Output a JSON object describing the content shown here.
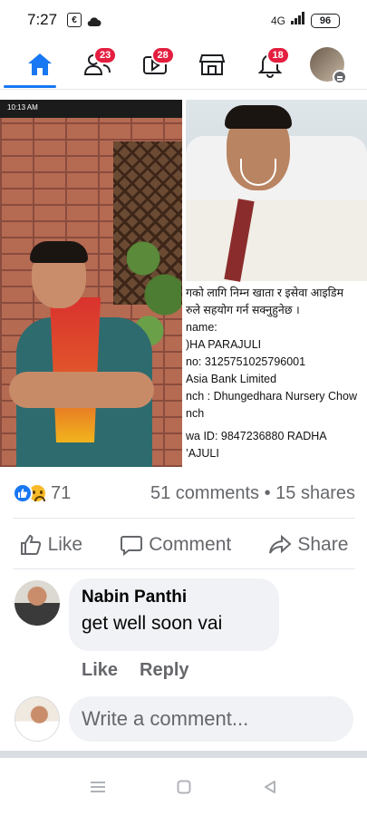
{
  "status_bar": {
    "time": "7:27",
    "left_icon_box": "€",
    "signal": "4G",
    "battery": "96"
  },
  "nav": {
    "items": [
      {
        "name": "home",
        "badge": ""
      },
      {
        "name": "friends",
        "badge": "23"
      },
      {
        "name": "watch",
        "badge": "28"
      },
      {
        "name": "marketplace",
        "badge": ""
      },
      {
        "name": "notifications",
        "badge": "18"
      },
      {
        "name": "profile-menu",
        "badge": ""
      }
    ],
    "active_color": "#1877f2",
    "badge_color": "#e41e3f"
  },
  "post": {
    "left_photo": {
      "phone_status_time": "10:13 AM"
    },
    "right_photo": {
      "info_lines": [
        "गको लागि निम्न खाता र इसेवा आइडिम",
        "रुले सहयोग गर्न सक्नुहुनेछ ।",
        "name:",
        ")HA PARAJULI",
        "no: 3125751025796001",
        "Asia Bank Limited",
        "nch : Dhungedhara Nursery Chow",
        "nch",
        "wa ID: 9847236880 RADHA",
        "’AJULI"
      ]
    },
    "reactions": {
      "count": "71",
      "comments_shares": "51 comments • 15 shares"
    },
    "actions": {
      "like": "Like",
      "comment": "Comment",
      "share": "Share"
    }
  },
  "comment": {
    "author": "Nabin Panthi",
    "text": "get well soon vai",
    "like_label": "Like",
    "reply_label": "Reply"
  },
  "composer": {
    "placeholder": "Write a comment..."
  }
}
